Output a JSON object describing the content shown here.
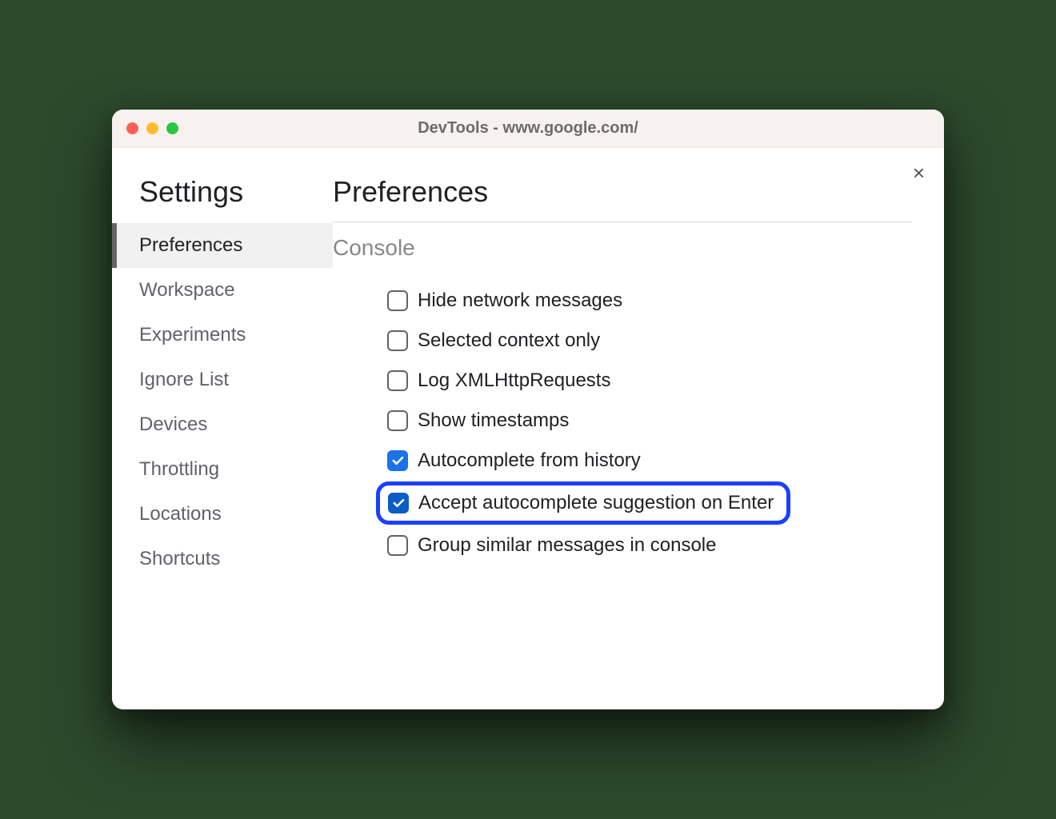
{
  "window": {
    "title": "DevTools - www.google.com/"
  },
  "sidebar": {
    "heading": "Settings",
    "items": [
      {
        "label": "Preferences",
        "active": true
      },
      {
        "label": "Workspace",
        "active": false
      },
      {
        "label": "Experiments",
        "active": false
      },
      {
        "label": "Ignore List",
        "active": false
      },
      {
        "label": "Devices",
        "active": false
      },
      {
        "label": "Throttling",
        "active": false
      },
      {
        "label": "Locations",
        "active": false
      },
      {
        "label": "Shortcuts",
        "active": false
      }
    ]
  },
  "main": {
    "title": "Preferences",
    "section": "Console",
    "options": [
      {
        "label": "Hide network messages",
        "checked": false,
        "highlight": false
      },
      {
        "label": "Selected context only",
        "checked": false,
        "highlight": false
      },
      {
        "label": "Log XMLHttpRequests",
        "checked": false,
        "highlight": false
      },
      {
        "label": "Show timestamps",
        "checked": false,
        "highlight": false
      },
      {
        "label": "Autocomplete from history",
        "checked": true,
        "highlight": false
      },
      {
        "label": "Accept autocomplete suggestion on Enter",
        "checked": true,
        "highlight": true
      },
      {
        "label": "Group similar messages in console",
        "checked": false,
        "highlight": false
      }
    ]
  }
}
